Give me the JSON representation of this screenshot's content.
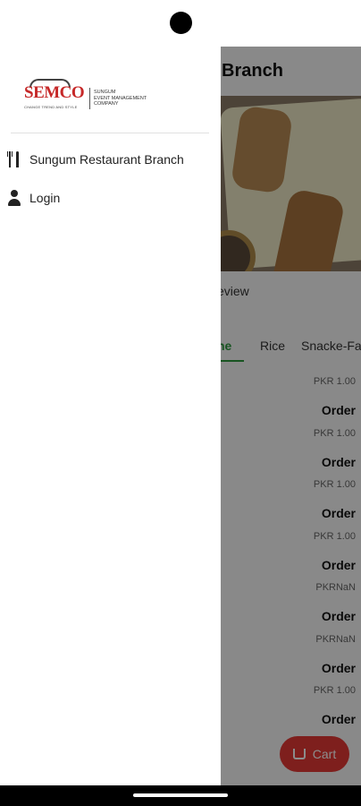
{
  "screen": {
    "title": "Branch",
    "review_label": "eview",
    "tabs": [
      {
        "label": "ne",
        "active": true
      },
      {
        "label": "Rice",
        "active": false
      },
      {
        "label": "Snacke-Fast",
        "active": false
      }
    ],
    "items": [
      {
        "price": "PKR 1.00",
        "order_label": "Order"
      },
      {
        "price": "PKR 1.00",
        "order_label": "Order"
      },
      {
        "price": "PKR 1.00",
        "order_label": "Order"
      },
      {
        "price": "PKR 1.00",
        "order_label": "Order"
      },
      {
        "price": "PKRNaN",
        "order_label": "Order"
      },
      {
        "price": "PKRNaN",
        "order_label": "Order"
      },
      {
        "price": "PKR 1.00",
        "order_label": "Order"
      }
    ],
    "cart_label": "Cart",
    "accent_color": "#2e9a3e",
    "cart_color": "#e53935"
  },
  "drawer": {
    "logo": {
      "mark": "SEMCO",
      "tagline": "CHANGE TREND AND STYLE",
      "company": "SUNGUM\nEVENT MANAGEMENT\nCOMPANY"
    },
    "items": [
      {
        "label": "Sungum Restaurant Branch",
        "icon": "fork-knife-icon"
      },
      {
        "label": "Login",
        "icon": "person-icon"
      }
    ]
  }
}
